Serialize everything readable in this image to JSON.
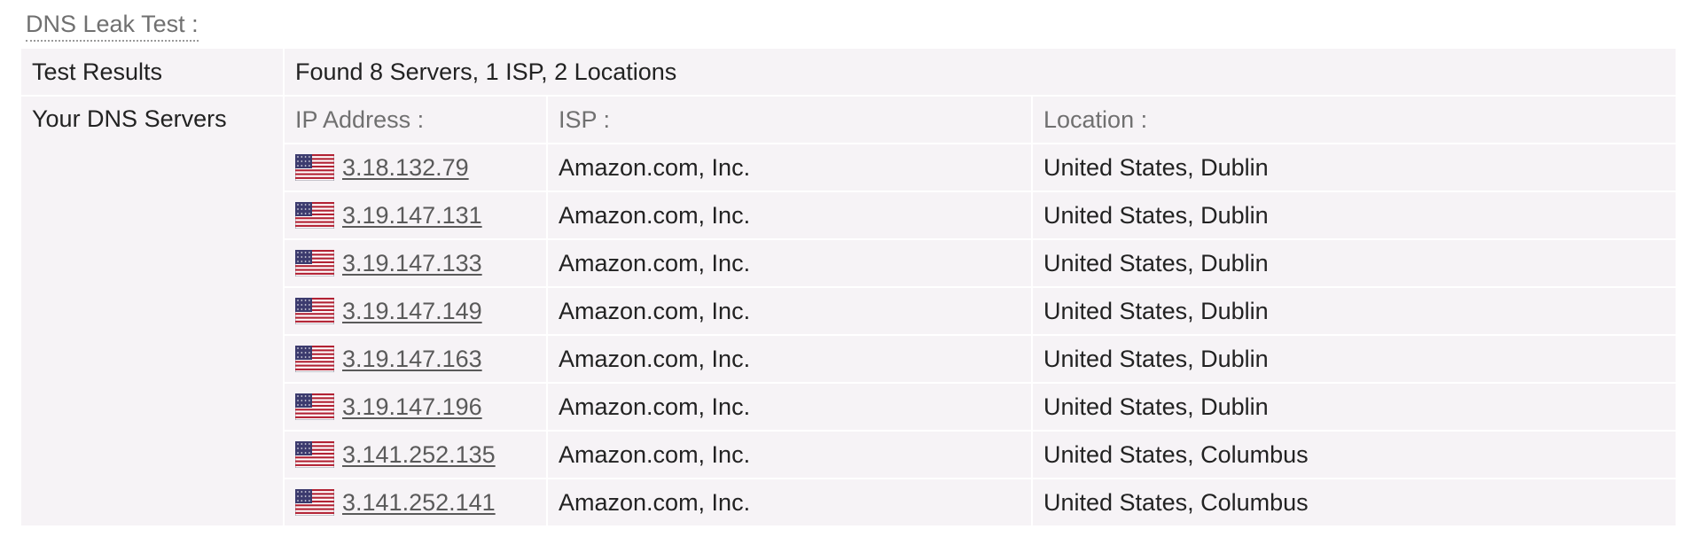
{
  "section_title": "DNS Leak Test :",
  "summary": {
    "label": "Test Results",
    "value": "Found 8 Servers, 1 ISP, 2 Locations"
  },
  "servers": {
    "label": "Your DNS Servers",
    "headers": {
      "ip": "IP Address :",
      "isp": "ISP :",
      "location": "Location :"
    },
    "rows": [
      {
        "flag": "us-flag-icon",
        "ip": "3.18.132.79",
        "isp": "Amazon.com, Inc.",
        "location": "United States, Dublin"
      },
      {
        "flag": "us-flag-icon",
        "ip": "3.19.147.131",
        "isp": "Amazon.com, Inc.",
        "location": "United States, Dublin"
      },
      {
        "flag": "us-flag-icon",
        "ip": "3.19.147.133",
        "isp": "Amazon.com, Inc.",
        "location": "United States, Dublin"
      },
      {
        "flag": "us-flag-icon",
        "ip": "3.19.147.149",
        "isp": "Amazon.com, Inc.",
        "location": "United States, Dublin"
      },
      {
        "flag": "us-flag-icon",
        "ip": "3.19.147.163",
        "isp": "Amazon.com, Inc.",
        "location": "United States, Dublin"
      },
      {
        "flag": "us-flag-icon",
        "ip": "3.19.147.196",
        "isp": "Amazon.com, Inc.",
        "location": "United States, Dublin"
      },
      {
        "flag": "us-flag-icon",
        "ip": "3.141.252.135",
        "isp": "Amazon.com, Inc.",
        "location": "United States, Columbus"
      },
      {
        "flag": "us-flag-icon",
        "ip": "3.141.252.141",
        "isp": "Amazon.com, Inc.",
        "location": "United States, Columbus"
      }
    ]
  },
  "colors": {
    "cell_background": "#f6f3f6",
    "muted_text": "#707070",
    "body_text": "#222222",
    "link_text": "#5a5a5a"
  }
}
